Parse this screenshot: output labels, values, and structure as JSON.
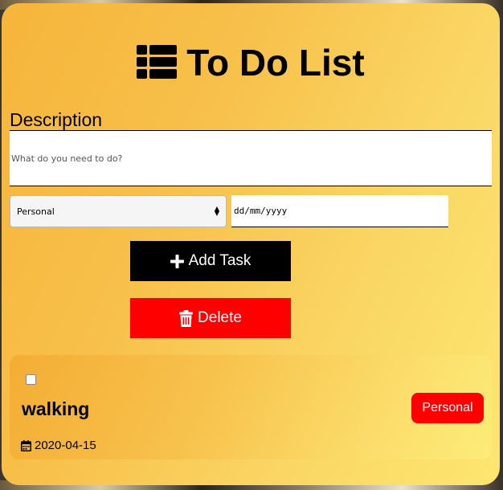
{
  "header": {
    "title": "To Do List",
    "icon": "list-icon"
  },
  "form": {
    "description_label": "Description",
    "description_placeholder": "What do you need to do?",
    "category_selected": "Personal",
    "date_placeholder": "dd/mm/yyyy",
    "add_button_label": "Add Task",
    "delete_button_label": "Delete"
  },
  "tasks": [
    {
      "title": "walking",
      "category": "Personal",
      "date": "2020-04-15",
      "checked": false
    }
  ],
  "colors": {
    "accent_red": "#ff0000",
    "button_black": "#000000",
    "card_gradient_start": "#f6b53b",
    "card_gradient_end": "#fde670"
  }
}
